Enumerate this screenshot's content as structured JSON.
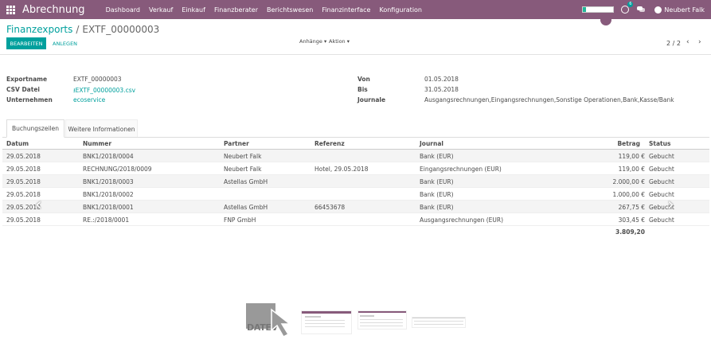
{
  "navbar": {
    "brand": "Abrechnung",
    "menu": [
      "Dashboard",
      "Verkauf",
      "Einkauf",
      "Finanzberater",
      "Berichtswesen",
      "Finanzinterface",
      "Konfiguration"
    ],
    "activity_count": "6",
    "user_name": "Neubert Falk",
    "accent_color": "#875a7b"
  },
  "breadcrumb": {
    "parent": "Finanzexports",
    "separator": "/",
    "current": "EXTF_00000003"
  },
  "actions": {
    "edit": "BEARBEITEN",
    "create": "ANLEGEN",
    "attachments": "Anhänge",
    "action": "Aktion"
  },
  "pager": {
    "value": "2 / 2",
    "prev": "‹",
    "next": "›"
  },
  "form": {
    "export_name_label": "Exportname",
    "export_name": "EXTF_00000003",
    "csv_label": "CSV Datei",
    "csv_file": "EXTF_00000003.csv",
    "company_label": "Unternehmen",
    "company": "ecoservice",
    "from_label": "Von",
    "from": "01.05.2018",
    "to_label": "Bis",
    "to": "31.05.2018",
    "journals_label": "Journale",
    "journals": "Ausgangsrechnungen,Eingangsrechnungen,Sonstige Operationen,Bank,Kasse/Bank"
  },
  "tabs": [
    "Buchungszeilen",
    "Weitere Informationen"
  ],
  "table": {
    "headers": {
      "date": "Datum",
      "number": "Nummer",
      "partner": "Partner",
      "ref": "Referenz",
      "journal": "Journal",
      "amount": "Betrag",
      "status": "Status"
    },
    "rows": [
      {
        "date": "29.05.2018",
        "number": "BNK1/2018/0004",
        "partner": "Neubert Falk",
        "ref": "",
        "journal": "Bank (EUR)",
        "amount": "119,00 €",
        "status": "Gebucht"
      },
      {
        "date": "29.05.2018",
        "number": "RECHNUNG/2018/0009",
        "partner": "Neubert Falk",
        "ref": "Hotel, 29.05.2018",
        "journal": "Eingangsrechnungen (EUR)",
        "amount": "119,00 €",
        "status": "Gebucht"
      },
      {
        "date": "29.05.2018",
        "number": "BNK1/2018/0003",
        "partner": "Astellas GmbH",
        "ref": "",
        "journal": "Bank (EUR)",
        "amount": "2.000,00 €",
        "status": "Gebucht"
      },
      {
        "date": "29.05.2018",
        "number": "BNK1/2018/0002",
        "partner": "",
        "ref": "",
        "journal": "Bank (EUR)",
        "amount": "1.000,00 €",
        "status": "Gebucht"
      },
      {
        "date": "29.05.2018",
        "number": "BNK1/2018/0001",
        "partner": "Astellas GmbH",
        "ref": "66453678",
        "journal": "Bank (EUR)",
        "amount": "267,75 €",
        "status": "Gebucht"
      },
      {
        "date": "29.05.2018",
        "number": "RE.:/2018/0001",
        "partner": "FNP GmbH",
        "ref": "",
        "journal": "Ausgangsrechnungen (EUR)",
        "amount": "303,45 €",
        "status": "Gebucht"
      }
    ],
    "total": "3.809,20"
  },
  "logo": {
    "text": "DATEV"
  },
  "colors": {
    "teal": "#00a09d",
    "purple": "#875a7b"
  }
}
